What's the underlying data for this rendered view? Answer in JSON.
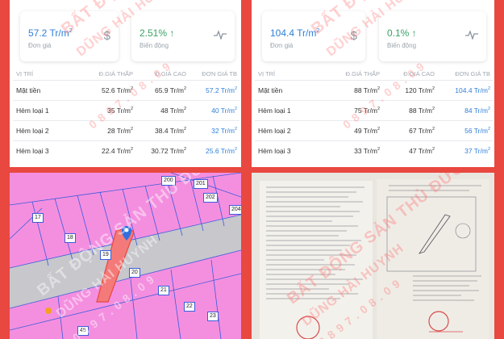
{
  "panels": [
    {
      "cards": [
        {
          "value": "57.2 Tr/m",
          "sup": "2",
          "sub": "Đơn giá",
          "icon": "dollar-icon"
        },
        {
          "value": "2.51% ↑",
          "sub": "Biến động",
          "icon": "pulse-icon"
        }
      ],
      "headers": [
        "VỊ TRÍ",
        "Đ.GIÁ THẤP",
        "Đ.GIÁ CAO",
        "ĐƠN GIÁ TB"
      ],
      "rows": [
        {
          "pos": "Mặt tiền",
          "low": "52.6 Tr/m",
          "high": "65.9 Tr/m",
          "avg": "57.2 Tr/m"
        },
        {
          "pos": "Hẻm loại 1",
          "low": "35 Tr/m",
          "high": "48 Tr/m",
          "avg": "40 Tr/m"
        },
        {
          "pos": "Hẻm loại 2",
          "low": "28 Tr/m",
          "high": "38.4 Tr/m",
          "avg": "32 Tr/m"
        },
        {
          "pos": "Hẻm loại 3",
          "low": "22.4 Tr/m",
          "high": "30.72 Tr/m",
          "avg": "25.6 Tr/m"
        }
      ]
    },
    {
      "cards": [
        {
          "value": "104.4 Tr/m",
          "sup": "2",
          "sub": "Đơn giá",
          "icon": "dollar-icon"
        },
        {
          "value": "0.1% ↑",
          "sub": "Biến động",
          "icon": "pulse-icon"
        }
      ],
      "headers": [
        "VỊ TRÍ",
        "Đ.GIÁ THẤP",
        "Đ.GIÁ CAO",
        "ĐƠN GIÁ TB"
      ],
      "rows": [
        {
          "pos": "Mặt tiền",
          "low": "88 Tr/m",
          "high": "120 Tr/m",
          "avg": "104.4 Tr/m"
        },
        {
          "pos": "Hẻm loại 1",
          "low": "75 Tr/m",
          "high": "88 Tr/m",
          "avg": "84 Tr/m"
        },
        {
          "pos": "Hẻm loại 2",
          "low": "49 Tr/m",
          "high": "67 Tr/m",
          "avg": "56 Tr/m"
        },
        {
          "pos": "Hẻm loại 3",
          "low": "33 Tr/m",
          "high": "47 Tr/m",
          "avg": "37 Tr/m"
        }
      ]
    }
  ],
  "sup": "2",
  "watermark": "BẤT ĐỘNG SẢN THỦ ĐỨC",
  "watermark2": "DŨNG HẢI HUYNH",
  "watermark3": "0 8 9 7 . 0 8 . 0 9",
  "map": {
    "plots": [
      "200",
      "201",
      "202",
      "204",
      "17",
      "18",
      "19",
      "20",
      "21",
      "22",
      "23",
      "45"
    ],
    "colors": {
      "pink": "#f48fe0",
      "grey": "#c7c7cc",
      "highlight": "#f47a7a",
      "line": "#3b5bdb"
    }
  }
}
